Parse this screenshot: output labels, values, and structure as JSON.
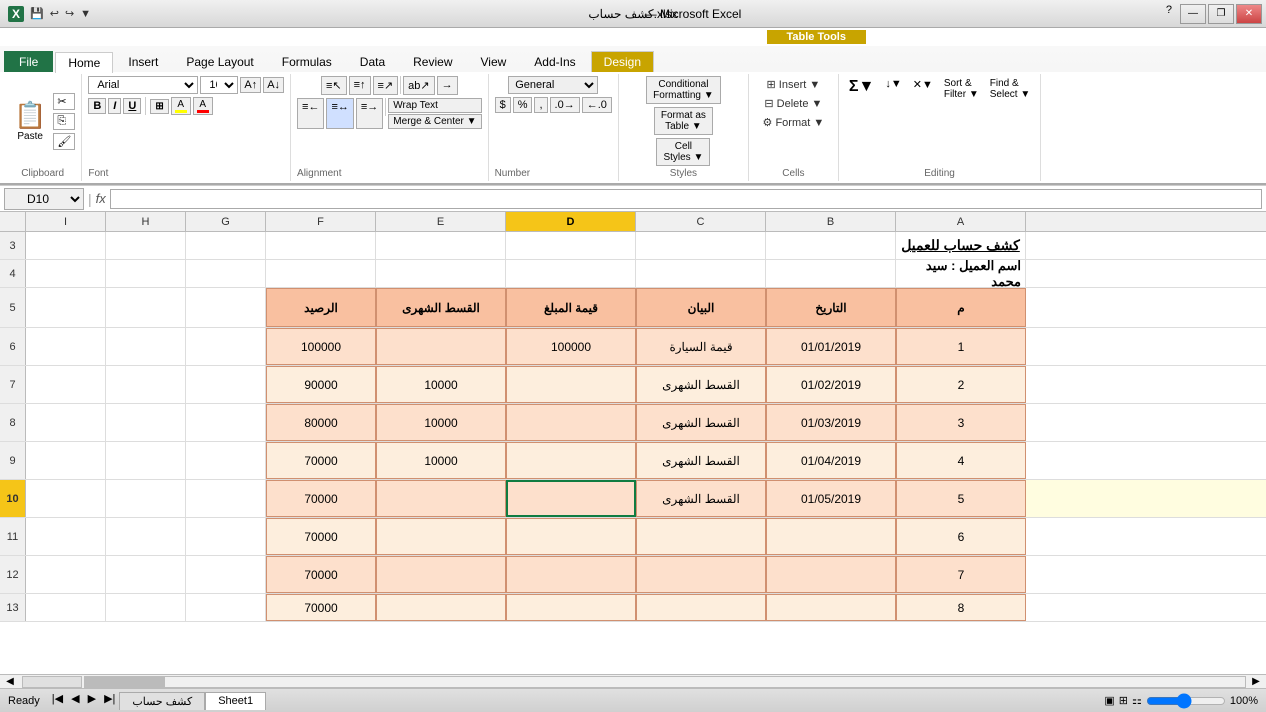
{
  "titleBar": {
    "filename": "كشف حساب.xlsx",
    "appName": "Microsoft Excel",
    "tableTool": "Table Tools",
    "quickAccess": [
      "💾",
      "↩",
      "↪"
    ]
  },
  "tableToolsBanner": {
    "label": "Table Tools"
  },
  "ribbon": {
    "tabs": [
      "File",
      "Home",
      "Insert",
      "Page Layout",
      "Formulas",
      "Data",
      "Review",
      "View",
      "Add-Ins",
      "Design"
    ],
    "activeTab": "Home",
    "designTab": "Design",
    "groups": {
      "clipboard": {
        "label": "Clipboard",
        "pasteLabel": "Paste"
      },
      "font": {
        "label": "Font",
        "fontName": "Arial",
        "fontSize": "16",
        "bold": "B",
        "italic": "I",
        "underline": "U"
      },
      "alignment": {
        "label": "Alignment"
      },
      "number": {
        "label": "Number",
        "format": "General"
      },
      "styles": {
        "label": "Styles",
        "conditionalLabel": "Conditional Formatting ▼",
        "formatAsTable": "Format as Table ▼",
        "cellStyles": "Cell Styles ▼"
      },
      "cells": {
        "label": "Cells",
        "insert": "Insert ▼",
        "delete": "Delete ▼",
        "format": "Format ▼"
      },
      "editing": {
        "label": "Editing",
        "sumLabel": "Σ▼",
        "fillLabel": "↓▼",
        "clearLabel": "✕▼",
        "sortFilter": "Sort & Filter ▼",
        "findSelect": "Find & Select ▼"
      }
    }
  },
  "formulaBar": {
    "nameBox": "D10",
    "fxLabel": "fx"
  },
  "columns": {
    "headers": [
      "I",
      "H",
      "G",
      "F",
      "E",
      "D",
      "C",
      "B",
      "A"
    ],
    "widths": [
      80,
      80,
      80,
      110,
      130,
      130,
      130,
      130,
      130,
      70
    ],
    "activeCol": "D"
  },
  "rows": [
    {
      "num": "3",
      "data": [
        "",
        "",
        "",
        "",
        "",
        "",
        "",
        "",
        ""
      ]
    },
    {
      "num": "4",
      "data": [
        "",
        "",
        "",
        "",
        "",
        "",
        "",
        "",
        ""
      ],
      "mergedContent": "اسم العميل : سيد محمد",
      "mergedDir": "rtl"
    },
    {
      "num": "5",
      "data": [
        "م",
        "التاريخ",
        "البيان",
        "قيمة المبلغ",
        "القسط الشهرى",
        "الرصيد",
        "",
        "",
        ""
      ],
      "isHeader": true
    },
    {
      "num": "6",
      "data": [
        "1",
        "01/01/2019",
        "قيمة السيارة",
        "100000",
        "",
        "100000",
        "",
        "",
        ""
      ],
      "isData": true
    },
    {
      "num": "7",
      "data": [
        "2",
        "01/02/2019",
        "القسط الشهرى",
        "",
        "10000",
        "90000",
        "",
        "",
        ""
      ],
      "isData": true
    },
    {
      "num": "8",
      "data": [
        "3",
        "01/03/2019",
        "القسط الشهرى",
        "",
        "10000",
        "80000",
        "",
        "",
        ""
      ],
      "isData": true
    },
    {
      "num": "9",
      "data": [
        "4",
        "01/04/2019",
        "القسط الشهرى",
        "",
        "10000",
        "70000",
        "",
        "",
        ""
      ],
      "isData": true
    },
    {
      "num": "10",
      "data": [
        "5",
        "01/05/2019",
        "القسط الشهرى",
        "",
        "",
        "70000",
        "",
        "",
        ""
      ],
      "isData": true,
      "activeRow": true
    },
    {
      "num": "11",
      "data": [
        "6",
        "",
        "",
        "",
        "",
        "70000",
        "",
        "",
        ""
      ],
      "isData": true
    },
    {
      "num": "12",
      "data": [
        "7",
        "",
        "",
        "",
        "",
        "70000",
        "",
        "",
        ""
      ],
      "isData": true
    },
    {
      "num": "13",
      "data": [
        "8",
        "",
        "",
        "",
        "",
        "70000",
        "",
        "",
        ""
      ],
      "isData": true,
      "partial": true
    }
  ],
  "title": "كشف حساب للعميل",
  "statusBar": {
    "status": "Ready",
    "sheets": [
      "كشف حساب",
      "Sheet1"
    ],
    "zoom": "100%"
  }
}
